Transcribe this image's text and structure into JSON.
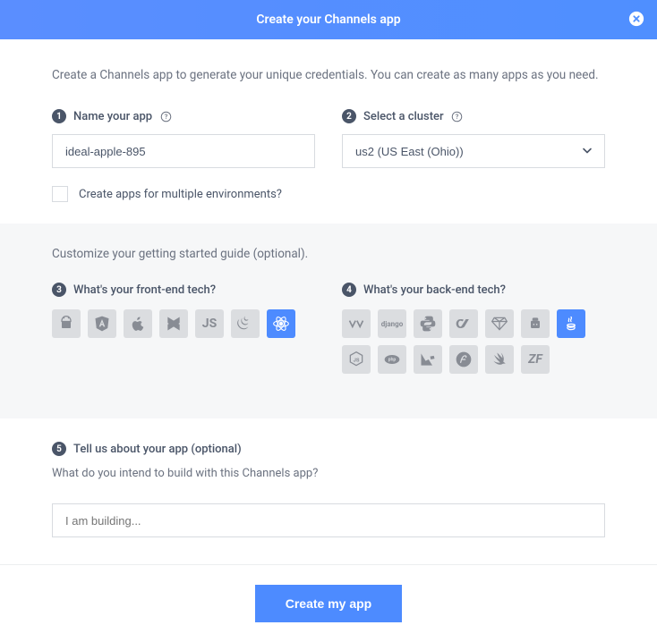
{
  "header": {
    "title": "Create your Channels app"
  },
  "intro": "Create a Channels app to generate your unique credentials. You can create as many apps as you need.",
  "step1": {
    "num": "1",
    "label": "Name your app",
    "value": "ideal-apple-895"
  },
  "step2": {
    "num": "2",
    "label": "Select a cluster",
    "value": "us2 (US East (Ohio))"
  },
  "multi_env": {
    "label": "Create apps for multiple environments?"
  },
  "customize": {
    "title": "Customize your getting started guide (optional)."
  },
  "step3": {
    "num": "3",
    "label": "What's your front-end tech?"
  },
  "step4": {
    "num": "4",
    "label": "What's your back-end tech?"
  },
  "frontend": {
    "items": [
      "android",
      "angular",
      "ios",
      "backbone",
      "js",
      "jquery",
      "react"
    ],
    "selected": "react"
  },
  "backend": {
    "items": [
      "dotnet",
      "django",
      "python",
      "go",
      "ruby",
      "rust",
      "java",
      "nodejs",
      "php",
      "laravel",
      "symfony",
      "swift",
      "zend"
    ],
    "selected": "java"
  },
  "step5": {
    "num": "5",
    "label": "Tell us about your app (optional)",
    "sub": "What do you intend to build with this Channels app?",
    "placeholder": "I am building..."
  },
  "footer": {
    "create": "Create my app"
  }
}
